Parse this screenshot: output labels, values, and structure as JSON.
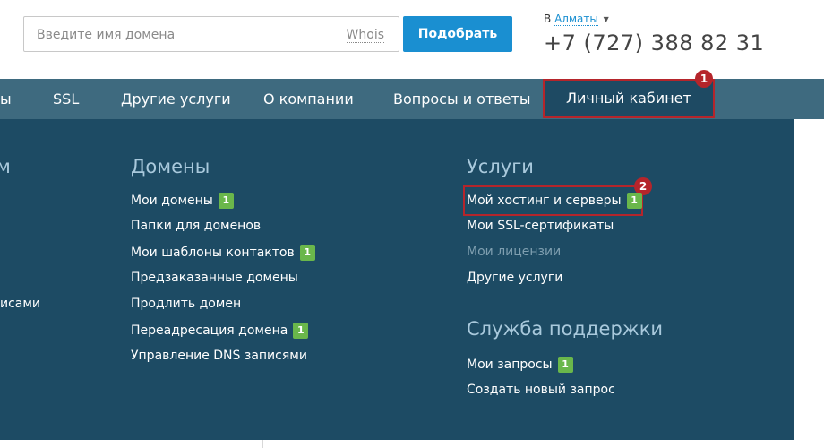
{
  "header": {
    "search_placeholder": "Введите имя домена",
    "whois_label": "Whois",
    "pick_button": "Подобрать",
    "city_prefix": "В",
    "city": "Алматы",
    "phone": "+7 (727) 388 82 31"
  },
  "nav": {
    "items": [
      {
        "label": "ы"
      },
      {
        "label": "SSL"
      },
      {
        "label": "Другие услуги"
      },
      {
        "label": "О компании"
      },
      {
        "label": "Вопросы и ответы"
      },
      {
        "label": "Личный кабинет",
        "active": true
      }
    ],
    "callout_1": "1"
  },
  "dropdown": {
    "col0": {
      "title": "м",
      "items": [
        {
          "label": "исами"
        }
      ]
    },
    "domains": {
      "title": "Домены",
      "items": [
        {
          "label": "Мои домены",
          "badge": "1"
        },
        {
          "label": "Папки для доменов"
        },
        {
          "label": "Мои шаблоны контактов",
          "badge": "1"
        },
        {
          "label": "Предзаказанные домены"
        },
        {
          "label": "Продлить домен"
        },
        {
          "label": "Переадресация домена",
          "badge": "1"
        },
        {
          "label": "Управление DNS записями"
        }
      ]
    },
    "services": {
      "title": "Услуги",
      "items": [
        {
          "label": "Мой хостинг и серверы",
          "badge": "1"
        },
        {
          "label": "Мои SSL-сертификаты"
        },
        {
          "label": "Мои лицензии",
          "disabled": true
        },
        {
          "label": "Другие услуги"
        }
      ],
      "callout_2": "2"
    },
    "support": {
      "title": "Служба поддержки",
      "items": [
        {
          "label": "Мои запросы",
          "badge": "1"
        },
        {
          "label": "Создать новый запрос"
        }
      ]
    }
  },
  "colors": {
    "accent": "#1a8fd1",
    "nav_bg": "#3e6a7f",
    "dropdown_bg": "#1d4b64",
    "badge": "#6ab74b",
    "highlight": "#b5252b"
  }
}
